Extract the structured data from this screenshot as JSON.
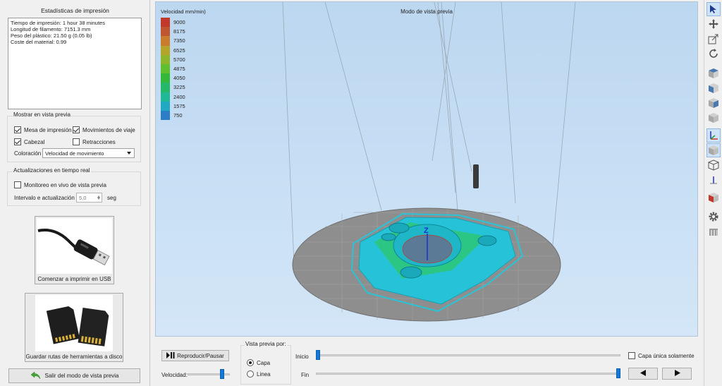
{
  "stats": {
    "title": "Estadísticas de impresión",
    "line1": "Tiempo de impresión: 1 hour 38 minutes",
    "line2": "Longitud de filamento: 7151.3 mm",
    "line3": "Peso del plástico: 21.50 g (0.05 lb)",
    "line4": "Coste del material: 0.99"
  },
  "preview": {
    "title": "Mostrar en vista previa",
    "bed": {
      "label": "Mesa de impresión",
      "checked": true
    },
    "travel": {
      "label": "Movimientos de viaje",
      "checked": true
    },
    "head": {
      "label": "Cabezal",
      "checked": true
    },
    "retractions": {
      "label": "Retracciones",
      "checked": false
    },
    "coloring_label": "Coloración",
    "coloring_value": "Velocidad de movimiento"
  },
  "realtime": {
    "title": "Actualizaciones en tiempo real",
    "monitor": {
      "label": "Monitoreo en vivo de vista previa",
      "checked": false
    },
    "interval_label": "Intervalo e actualización",
    "interval_value": "5,0",
    "interval_unit": "seg"
  },
  "usb_button": {
    "label": "Comenzar a imprimir en USB",
    "icon": "usb-cable-icon"
  },
  "disk_button": {
    "label": "Guardar rutas de herramientas a disco",
    "icon": "sd-card-icon"
  },
  "exit_button": {
    "label": "Salir del modo de vista previa",
    "icon": "green-back-arrow-icon"
  },
  "viewport": {
    "title": "Modo de vista previa",
    "legend_title": "Velocidad mm/min)",
    "legend": [
      {
        "value": "9000",
        "color": "#c0392b"
      },
      {
        "value": "8175",
        "color": "#c0562f"
      },
      {
        "value": "7350",
        "color": "#c97b2e"
      },
      {
        "value": "6525",
        "color": "#b5a42a"
      },
      {
        "value": "5700",
        "color": "#8fb52a"
      },
      {
        "value": "4875",
        "color": "#5fbf2e"
      },
      {
        "value": "4050",
        "color": "#33b83a"
      },
      {
        "value": "3225",
        "color": "#26b869"
      },
      {
        "value": "2400",
        "color": "#21b896"
      },
      {
        "value": "1575",
        "color": "#22a9c2"
      },
      {
        "value": "750",
        "color": "#2b7dc6"
      }
    ],
    "axis_label": "Z"
  },
  "controls": {
    "play_label": "Reproducir/Pausar",
    "play_icon": "play-pause-icon",
    "speed_label": "Velocidad:",
    "speed_level": 0.85,
    "view_by_title": "Vista previa por:",
    "layer_label": "Capa",
    "layer_selected": true,
    "line_label": "Linea",
    "start_label": "Inicio",
    "start_level": 0.0,
    "end_label": "Fin",
    "end_level": 1.0,
    "single_layer_label": "Capa única solamente",
    "prev_icon": "triangle-left-icon",
    "next_icon": "triangle-right-icon"
  },
  "toolbar": {
    "icons": [
      "select-cursor-icon",
      "move-icon",
      "scale-icon",
      "rotate-icon",
      "view-cube-top-icon",
      "view-cube-front-icon",
      "view-cube-side-icon",
      "view-cube-iso-icon",
      "axes-icon",
      "solid-cube-icon",
      "wireframe-cube-icon",
      "show-axis-icon",
      "section-view-icon",
      "settings-gear-icon",
      "machine-icon"
    ]
  },
  "colors": {
    "bed": "#8e8e8e",
    "model_cyan": "#26c3d8",
    "model_green": "#2cc77a",
    "accent_blue": "#1479d8"
  }
}
